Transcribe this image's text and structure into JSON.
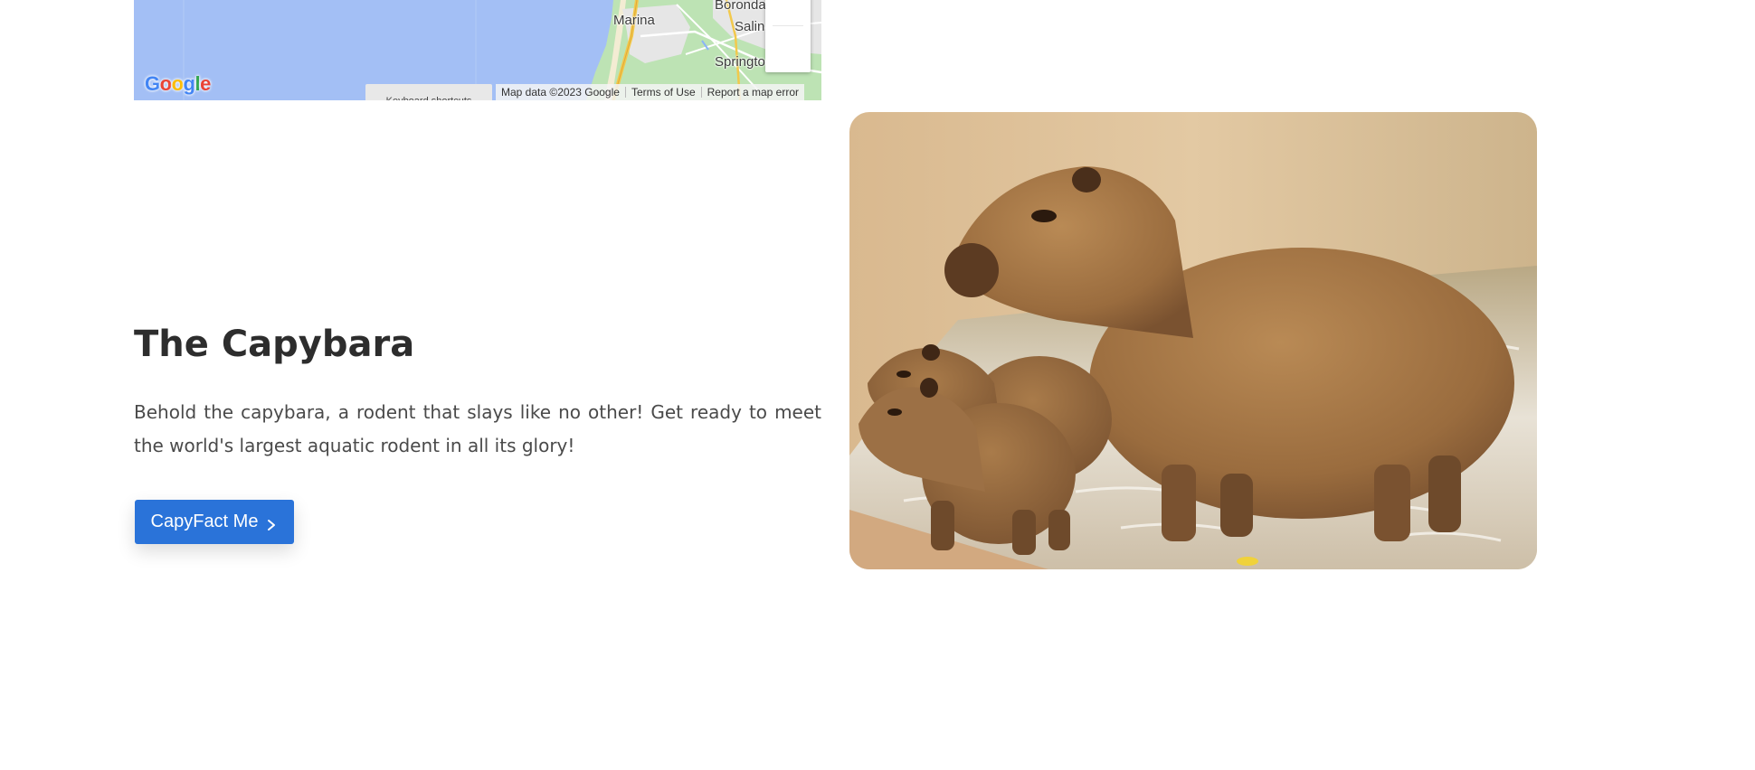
{
  "map": {
    "places": {
      "marina": "Marina",
      "boronda": "Boronda",
      "salinas": "Salin",
      "spring": "Springto"
    },
    "logo_letters": [
      "G",
      "o",
      "o",
      "g",
      "l",
      "e"
    ],
    "keyboard_shortcuts": "Keyboard shortcuts",
    "map_data": "Map data ©2023 Google",
    "terms": "Terms of Use",
    "report": "Report a map error",
    "colors": {
      "water": "#a3bff5",
      "land": "#bde3b4",
      "urban": "#e6e6e6",
      "road": "#f2c94c"
    }
  },
  "hero": {
    "title": "The Capybara",
    "description": "Behold the capybara, a rodent that slays like no other! Get ready to meet the world's largest aquatic rodent in all its glory!",
    "button_label": "CapyFact Me",
    "button_icon": "chevron-right-icon",
    "accent_color": "#2a73d9"
  },
  "photo": {
    "subject": "capybara-family-photo"
  }
}
